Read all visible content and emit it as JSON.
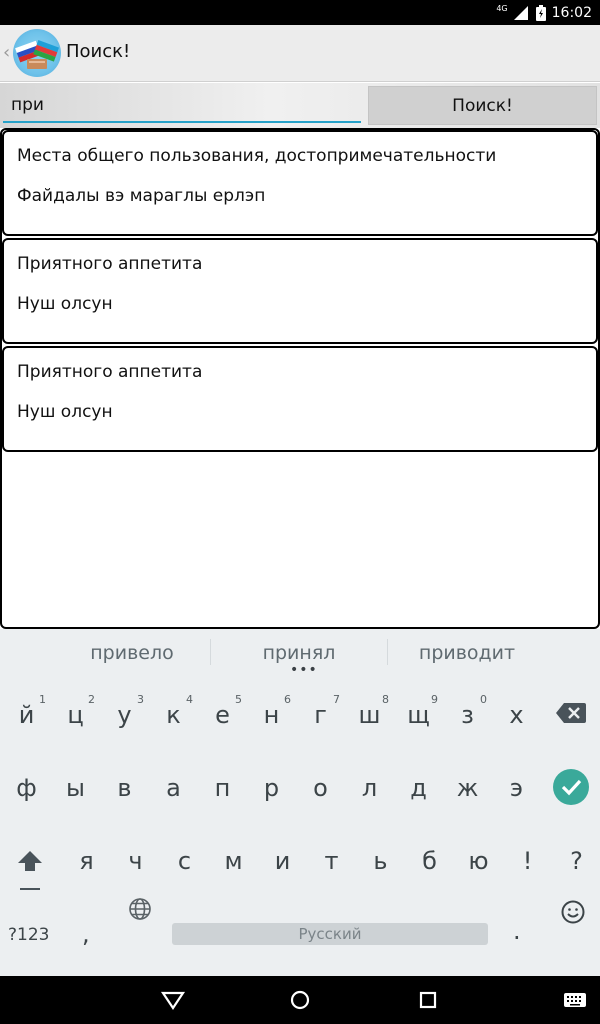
{
  "status_bar": {
    "network": "4G",
    "time": "16:02"
  },
  "action_bar": {
    "title": "Поиск!"
  },
  "search": {
    "query": "при",
    "button_label": "Поиск!"
  },
  "results": [
    {
      "russian": "Места общего пользования, достопримечательности",
      "azerbaijani": "Файдалы вэ мараглы ерлэп"
    },
    {
      "russian": "Приятного аппетита",
      "azerbaijani": "Нуш олсун"
    },
    {
      "russian": "Приятного аппетита",
      "azerbaijani": "Нуш олсун"
    }
  ],
  "keyboard": {
    "suggestions": [
      "привело",
      "принял",
      "приводит"
    ],
    "row1": [
      {
        "k": "й",
        "h": "1"
      },
      {
        "k": "ц",
        "h": "2"
      },
      {
        "k": "у",
        "h": "3"
      },
      {
        "k": "к",
        "h": "4"
      },
      {
        "k": "е",
        "h": "5"
      },
      {
        "k": "н",
        "h": "6"
      },
      {
        "k": "г",
        "h": "7"
      },
      {
        "k": "ш",
        "h": "8"
      },
      {
        "k": "щ",
        "h": "9"
      },
      {
        "k": "з",
        "h": "0"
      },
      {
        "k": "х",
        "h": ""
      }
    ],
    "row2": [
      "ф",
      "ы",
      "в",
      "а",
      "п",
      "р",
      "о",
      "л",
      "д",
      "ж",
      "э"
    ],
    "row3": [
      "я",
      "ч",
      "с",
      "м",
      "и",
      "т",
      "ь",
      "б",
      "ю",
      "!",
      "?"
    ],
    "symbols_label": "?123",
    "comma": ",",
    "period": ".",
    "space_label": "Русский"
  },
  "colors": {
    "accent": "#26a1c9",
    "enter_key": "#3aa99a",
    "keyboard_bg": "#eceff1"
  }
}
